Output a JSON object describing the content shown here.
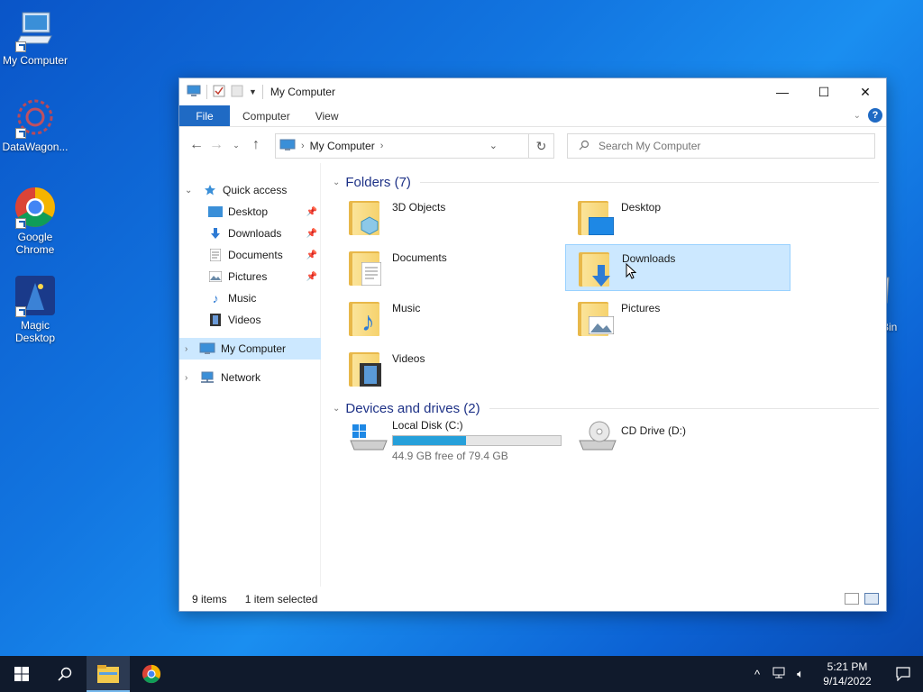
{
  "desktop": {
    "icons": [
      {
        "label": "My Computer"
      },
      {
        "label": "DataWagon..."
      },
      {
        "label": "Google Chrome"
      },
      {
        "label": "Magic Desktop"
      }
    ],
    "recycle_partial": "Bin"
  },
  "window": {
    "title": "My Computer",
    "controls": {
      "minimize": "—",
      "maximize": "☐",
      "close": "✕"
    },
    "ribbon_tabs": [
      {
        "label": "File",
        "active": true
      },
      {
        "label": "Computer"
      },
      {
        "label": "View"
      }
    ],
    "address": {
      "crumb": "My Computer"
    },
    "search": {
      "placeholder": "Search My Computer"
    },
    "nav": {
      "quick_access": "Quick access",
      "items": [
        {
          "label": "Desktop",
          "pinned": true
        },
        {
          "label": "Downloads",
          "pinned": true
        },
        {
          "label": "Documents",
          "pinned": true
        },
        {
          "label": "Pictures",
          "pinned": true
        },
        {
          "label": "Music"
        },
        {
          "label": "Videos"
        }
      ],
      "my_computer": "My Computer",
      "network": "Network"
    },
    "groups": {
      "folders": "Folders (7)",
      "drives": "Devices and drives (2)"
    },
    "folders": [
      {
        "label": "3D Objects"
      },
      {
        "label": "Desktop"
      },
      {
        "label": "Documents"
      },
      {
        "label": "Downloads",
        "selected": true
      },
      {
        "label": "Music"
      },
      {
        "label": "Pictures"
      },
      {
        "label": "Videos"
      }
    ],
    "drives": [
      {
        "label": "Local Disk (C:)",
        "free_text": "44.9 GB free of 79.4 GB",
        "used_fraction": 0.435
      },
      {
        "label": "CD Drive (D:)"
      }
    ],
    "status": {
      "count": "9 items",
      "selected": "1 item selected"
    }
  },
  "taskbar": {
    "time": "5:21 PM",
    "date": "9/14/2022"
  },
  "colors": {
    "accent": "#1f6ac4",
    "selection": "#cce8ff",
    "drive_fill": "#26a0da"
  }
}
